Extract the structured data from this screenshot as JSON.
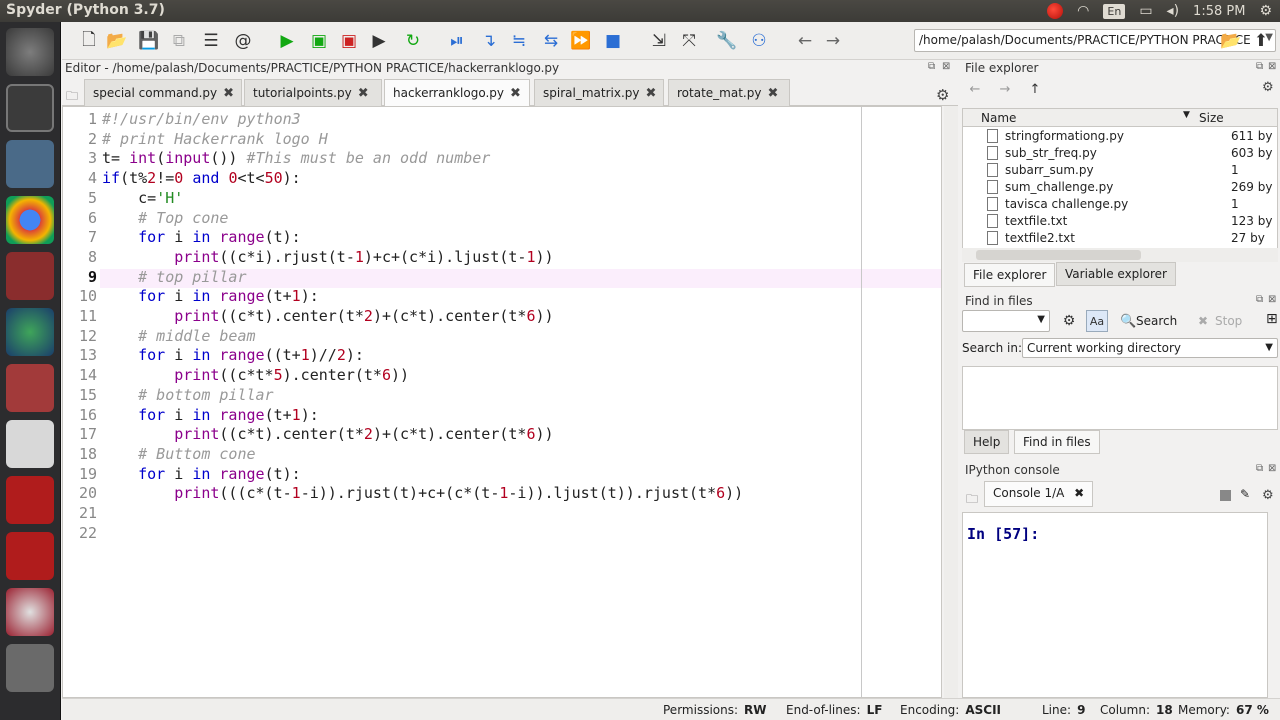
{
  "window": {
    "title": "Spyder (Python 3.7)"
  },
  "tray": {
    "lang": "En",
    "clock": "1:58 PM"
  },
  "toolbar": {
    "path": "/home/palash/Documents/PRACTICE/PYTHON PRACTICE"
  },
  "editor": {
    "title": "Editor - /home/palash/Documents/PRACTICE/PYTHON PRACTICE/hackerranklogo.py",
    "tabs": [
      {
        "label": "special command.py"
      },
      {
        "label": "tutorialpoints.py"
      },
      {
        "label": "hackerranklogo.py"
      },
      {
        "label": "spiral_matrix.py"
      },
      {
        "label": "rotate_mat.py"
      }
    ],
    "active_tab": 2,
    "current_line": 9,
    "lines": [
      "#!/usr/bin/env python3",
      "# print Hackerrank logo H",
      "t= int(input()) #This must be an odd number",
      "if(t%2!=0 and 0<t<50):",
      "    c='H'",
      "    # Top cone",
      "    for i in range(t):",
      "        print((c*i).rjust(t-1)+c+(c*i).ljust(t-1))",
      "    # top pillar",
      "    for i in range(t+1):",
      "        print((c*t).center(t*2)+(c*t).center(t*6))",
      "    # middle beam",
      "    for i in range((t+1)//2):",
      "        print((c*t*5).center(t*6))",
      "    # bottom pillar",
      "    for i in range(t+1):",
      "        print((c*t).center(t*2)+(c*t).center(t*6))",
      "    # Buttom cone",
      "    for i in range(t):",
      "        print(((c*(t-1-i)).rjust(t)+c+(c*(t-1-i)).ljust(t)).rjust(t*6))",
      "",
      ""
    ]
  },
  "file_explorer": {
    "title": "File explorer",
    "col_name": "Name",
    "col_size": "Size",
    "files": [
      {
        "name": "stringformationg.py",
        "size": "611 by"
      },
      {
        "name": "sub_str_freq.py",
        "size": "603 by"
      },
      {
        "name": "subarr_sum.py",
        "size": "1"
      },
      {
        "name": "sum_challenge.py",
        "size": "269 by"
      },
      {
        "name": "tavisca challenge.py",
        "size": "1"
      },
      {
        "name": "textfile.txt",
        "size": "123 by"
      },
      {
        "name": "textfile2.txt",
        "size": "27 by"
      }
    ],
    "tabs": [
      "File explorer",
      "Variable explorer"
    ]
  },
  "find_in_files": {
    "title": "Find in files",
    "search_label": "Search",
    "stop_label": "Stop",
    "search_in_label": "Search in:",
    "search_in_value": "Current working directory",
    "tabs": [
      "Help",
      "Find in files"
    ]
  },
  "console": {
    "title": "IPython console",
    "tab": "Console 1/A",
    "prompt": "In [57]:"
  },
  "status": {
    "permissions_label": "Permissions:",
    "permissions": "RW",
    "eol_label": "End-of-lines:",
    "eol": "LF",
    "encoding_label": "Encoding:",
    "encoding": "ASCII",
    "line_label": "Line:",
    "line": "9",
    "column_label": "Column:",
    "column": "18",
    "memory_label": "Memory:",
    "memory": "67 %"
  }
}
